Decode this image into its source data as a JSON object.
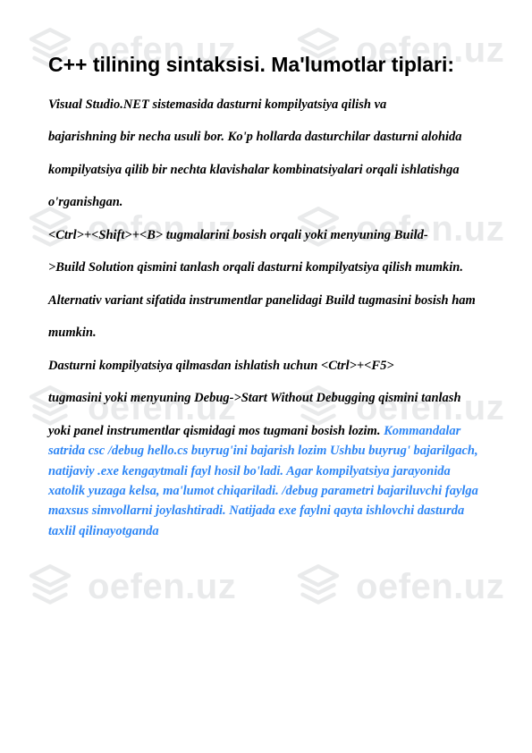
{
  "watermark": {
    "text": "oefen.uz"
  },
  "title": "C++ tilining sintaksisi. Ma'lumotlar tiplari:",
  "paragraphs": [
    "Visual Studio.NET sistemasida dasturni kompilyatsiya qilish va",
    "bajarishning bir necha usuli bor. Ko'p hollarda dasturchilar dasturni alohida",
    "kompilyatsiya qilib bir nechta klavishalar kombinatsiyalari orqali ishlatishga",
    "o'rganishgan.",
    "<Ctrl>+<Shift>+<B> tugmalarini bosish orqali yoki menyuning Build-",
    ">Build Solution qismini tanlash orqali dasturni kompilyatsiya qilish mumkin.",
    "Alternativ variant sifatida instrumentlar panelidagi Build tugmasini bosish ham",
    "mumkin.",
    "Dasturni kompilyatsiya qilmasdan ishlatish uchun <Ctrl>+<F5>",
    "tugmasini yoki menyuning Debug->Start Without Debugging qismini tanlash"
  ],
  "last_black": "yoki panel instrumentlar qismidagi mos tugmani bosish lozim.",
  "blue_tail": "  Kommandalar satrida csc /debug hello.cs buyrug'ini bajarish lozim Ushbu buyrug' bajarilgach, natijaviy .exe kengaytmali fayl hosil bo'ladi. Agar kompilyatsiya jarayonida xatolik yuzaga kelsa, ma'lumot chiqariladi. /debug parametri bajariluvchi faylga maxsus simvollarni joylashtiradi. Natijada exe faylni qayta ishlovchi dasturda taxlil qilinayotganda"
}
